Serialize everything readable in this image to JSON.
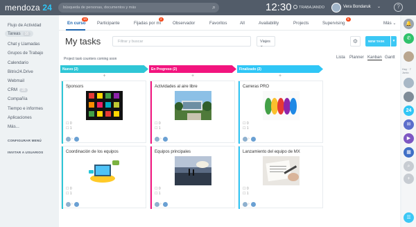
{
  "topbar": {
    "logo_text": "mendoza",
    "logo_num": "24",
    "search_placeholder": "búsqueda de personas, documentos y más",
    "clock": "12:30",
    "status": "TRABAJANDO",
    "user": "Vera Bondaruk",
    "help": "?"
  },
  "sidebar": {
    "items": [
      "Flujo de Actividad",
      "Tareas",
      "Chat y Llamadas",
      "Grupos de Trabajo",
      "Calendario",
      "Bitrix24.Drive",
      "Webmail",
      "CRM",
      "Compañía",
      "Tiempo e informes",
      "Aplicaciones",
      "Más..."
    ],
    "tareas_count": "16",
    "crm_count": "28",
    "config_menu": "CONFIGURAR MENÚ",
    "invite": "INVITAR A USUARIOS"
  },
  "tabs": [
    {
      "label": "En curso",
      "count": "10"
    },
    {
      "label": "Participante",
      "count": ""
    },
    {
      "label": "Fijadas por mí",
      "count": "2"
    },
    {
      "label": "Observador",
      "count": ""
    },
    {
      "label": "Favoritos",
      "count": ""
    },
    {
      "label": "All",
      "count": ""
    },
    {
      "label": "Availability",
      "count": ""
    },
    {
      "label": "Projects",
      "count": ""
    },
    {
      "label": "Supervising",
      "count": "8"
    }
  ],
  "more_tab": "Más",
  "header": {
    "title": "My tasks",
    "filter_placeholder": "Filtrar y buscar",
    "scope": "Viajes",
    "new_task": "NEW TASK",
    "counters_note": "Project task counters coming soon"
  },
  "views": [
    "Lista",
    "Planner",
    "Kanban",
    "Gantt"
  ],
  "columns": [
    {
      "name": "Nuevo",
      "count": "(2)",
      "color": "#2fc6d6"
    },
    {
      "name": "En Progreso",
      "count": "(2)",
      "color": "#f2147e"
    },
    {
      "name": "Finalizado",
      "count": "(2)",
      "color": "#2fc6f6"
    }
  ],
  "cards": [
    {
      "title": "Sponsors",
      "meta1": "0",
      "meta2": "1"
    },
    {
      "title": "Actividades al aire libre",
      "meta1": "0",
      "meta2": "1"
    },
    {
      "title": "Carreras PRO",
      "meta1": "0",
      "meta2": "1"
    },
    {
      "title": "Coordinación de los equipos",
      "meta1": "0",
      "meta2": "1"
    },
    {
      "title": "Equipos principales",
      "meta1": "0",
      "meta2": "1"
    },
    {
      "title": "Lanzamiento del equipo de MX",
      "meta1": "0",
      "meta2": "1"
    }
  ],
  "rail": {
    "note": "Hoy · 7 Junio",
    "icons": [
      "bell-icon",
      "whatsapp-icon",
      "avatar-icon",
      "24-icon",
      "chat-icon",
      "video-icon",
      "calendar-icon",
      "crm-icon"
    ]
  },
  "colors": {
    "accent": "#2067b0",
    "topbar": "#525c69",
    "new_task": "#3bc8f5"
  }
}
